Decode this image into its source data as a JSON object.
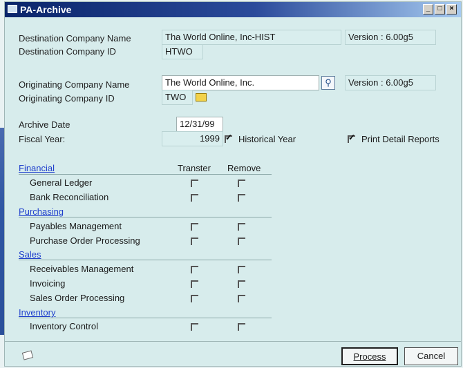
{
  "window": {
    "title": "PA-Archive"
  },
  "destination": {
    "company_name_label": "Destination Company Name",
    "company_name_value": "Tha World Online, Inc-HIST",
    "company_id_label": "Destination Company ID",
    "company_id_value": "HTWO",
    "version": "Version : 6.00g5"
  },
  "originating": {
    "company_name_label": "Originating Company Name",
    "company_name_value": "The World Online, Inc.",
    "company_id_label": "Originating Company ID",
    "company_id_value": "TWO",
    "version": "Version : 6.00g5"
  },
  "archive": {
    "date_label": "Archive Date",
    "date_value": "12/31/99",
    "fiscal_label": "Fiscal Year:",
    "fiscal_value": "1999",
    "historical_label": "Historical Year",
    "historical_checked": true,
    "print_detail_label": "Print Detail Reports",
    "print_detail_checked": true
  },
  "columns": {
    "transfer": "Transter",
    "remove": "Remove"
  },
  "sections": [
    {
      "name": "Financial",
      "items": [
        "General Ledger",
        "Bank Reconciliation"
      ]
    },
    {
      "name": "Purchasing",
      "items": [
        "Payables Management",
        "Purchase Order Processing"
      ]
    },
    {
      "name": "Sales",
      "items": [
        "Receivables Management",
        "Invoicing",
        "Sales Order Processing"
      ]
    },
    {
      "name": "Inventory",
      "items": [
        "Inventory Control"
      ]
    }
  ],
  "buttons": {
    "process": "Process",
    "cancel": "Cancel"
  }
}
